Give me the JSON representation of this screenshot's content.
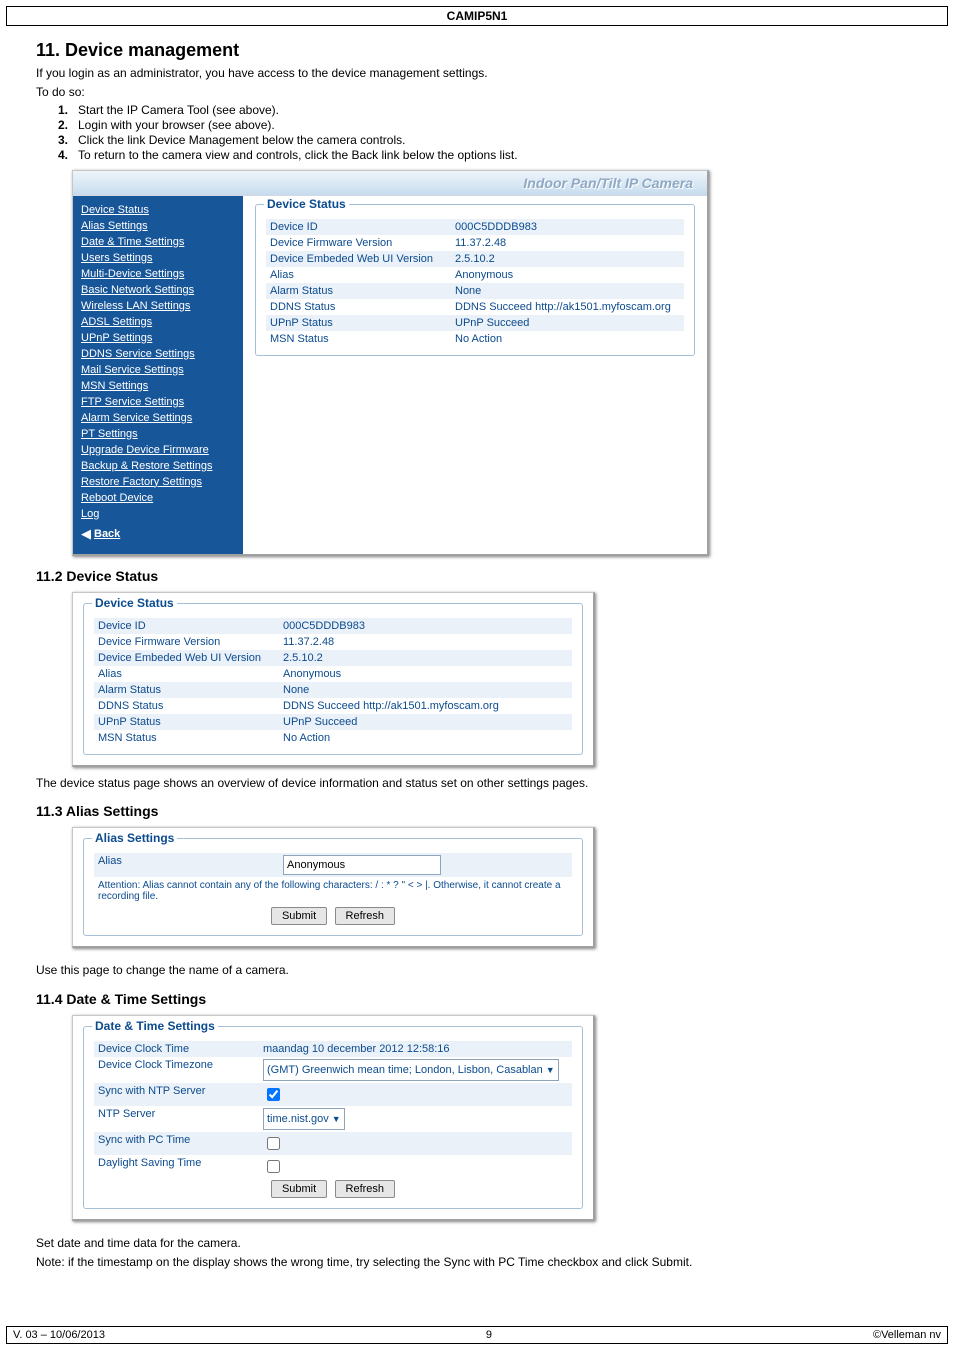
{
  "header": {
    "model": "CAMIP5N1"
  },
  "section": {
    "title": "11.   Device management",
    "intro1": "If you login as an administrator, you have access to the device management settings.",
    "intro2": "To do so:",
    "steps": [
      "Start the IP Camera Tool (see above).",
      "Login with your browser (see above).",
      "Click the link Device Management below the camera controls.",
      "To return to the camera view and controls, click the Back link below the options list."
    ]
  },
  "shot1": {
    "banner": "Indoor Pan/Tilt IP Camera",
    "sidebar": [
      "Device Status",
      "Alias Settings",
      "Date & Time Settings",
      "Users Settings",
      "Multi-Device Settings",
      "Basic Network Settings",
      "Wireless LAN Settings",
      "ADSL Settings",
      "UPnP Settings",
      "DDNS Service Settings",
      "Mail Service Settings",
      "MSN Settings",
      "FTP Service Settings",
      "Alarm Service Settings",
      "PT Settings",
      "Upgrade Device Firmware",
      "Backup & Restore Settings",
      "Restore Factory Settings",
      "Reboot Device",
      "Log"
    ],
    "back": "Back",
    "legend": "Device Status",
    "rows": [
      {
        "k": "Device ID",
        "v": "000C5DDDB983"
      },
      {
        "k": "Device Firmware Version",
        "v": "11.37.2.48"
      },
      {
        "k": "Device Embeded Web UI Version",
        "v": "2.5.10.2"
      },
      {
        "k": "Alias",
        "v": "Anonymous"
      },
      {
        "k": "Alarm Status",
        "v": "None"
      },
      {
        "k": "DDNS Status",
        "v": "DDNS Succeed  http://ak1501.myfoscam.org"
      },
      {
        "k": "UPnP Status",
        "v": "UPnP Succeed"
      },
      {
        "k": "MSN Status",
        "v": "No Action"
      }
    ]
  },
  "s112": {
    "title": "11.2   Device Status",
    "legend": "Device Status",
    "rows": [
      {
        "k": "Device ID",
        "v": "000C5DDDB983"
      },
      {
        "k": "Device Firmware Version",
        "v": "11.37.2.48"
      },
      {
        "k": "Device Embeded Web UI Version",
        "v": "2.5.10.2"
      },
      {
        "k": "Alias",
        "v": "Anonymous"
      },
      {
        "k": "Alarm Status",
        "v": "None"
      },
      {
        "k": "DDNS Status",
        "v": "DDNS Succeed  http://ak1501.myfoscam.org"
      },
      {
        "k": "UPnP Status",
        "v": "UPnP Succeed"
      },
      {
        "k": "MSN Status",
        "v": "No Action"
      }
    ],
    "caption": "The device status page shows an overview of device information and status set on other settings pages."
  },
  "s113": {
    "title": "11.3   Alias Settings",
    "legend": "Alias Settings",
    "row_k": "Alias",
    "row_v": "Anonymous",
    "note": "Attention: Alias cannot contain any of the following characters: / : * ? \" < > |. Otherwise, it cannot create a recording file.",
    "submit": "Submit",
    "refresh": "Refresh",
    "caption": "Use this page to change the name of a camera."
  },
  "s114": {
    "title": "11.4   Date & Time Settings",
    "legend": "Date & Time Settings",
    "rows": [
      {
        "k": "Device Clock Time",
        "v": "maandag 10 december 2012 12:58:16"
      },
      {
        "k": "Device Clock Timezone",
        "v": "(GMT) Greenwich mean time; London, Lisbon, Casablan"
      },
      {
        "k": "Sync with NTP Server",
        "v": "checkbox_checked"
      },
      {
        "k": "NTP Server",
        "v": "time.nist.gov"
      },
      {
        "k": "Sync with PC Time",
        "v": "checkbox"
      },
      {
        "k": "Daylight Saving Time",
        "v": "checkbox"
      }
    ],
    "submit": "Submit",
    "refresh": "Refresh",
    "caption1": "Set date and time data for the camera.",
    "caption2": "Note: if the timestamp on the display shows the wrong time, try selecting the Sync with PC Time checkbox and click Submit."
  },
  "footer": {
    "left": "V. 03 – 10/06/2013",
    "center": "9",
    "right": "©Velleman nv"
  }
}
